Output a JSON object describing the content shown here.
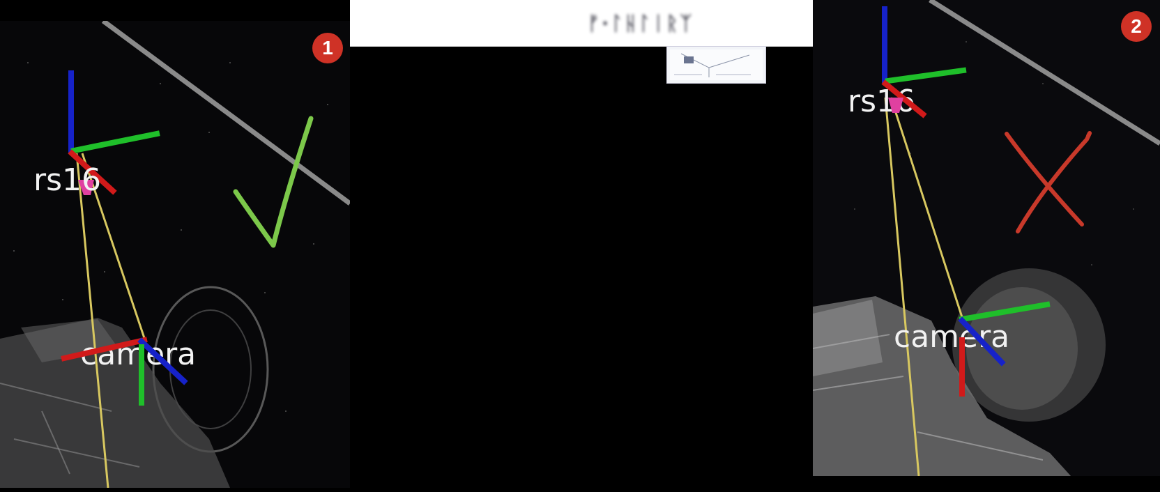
{
  "top_bar": {
    "blurred_title": "ᚠ·ᛚᚺᛚᛁᚱᛉ"
  },
  "panels": [
    {
      "id": "left",
      "badge": "1",
      "frames": [
        {
          "label": "rs16"
        },
        {
          "label": "camera"
        }
      ],
      "mark": "checkmark"
    },
    {
      "id": "right",
      "badge": "2",
      "frames": [
        {
          "label": "rs16"
        },
        {
          "label": "camera"
        }
      ],
      "mark": "cross"
    }
  ],
  "colors": {
    "axis_x": "#d11a1a",
    "axis_y": "#1fbf2a",
    "axis_z": "#1622c9",
    "link_line": "#d8c860",
    "check": "#7cc84a",
    "cross": "#c8392a",
    "badge": "#cf3226"
  }
}
